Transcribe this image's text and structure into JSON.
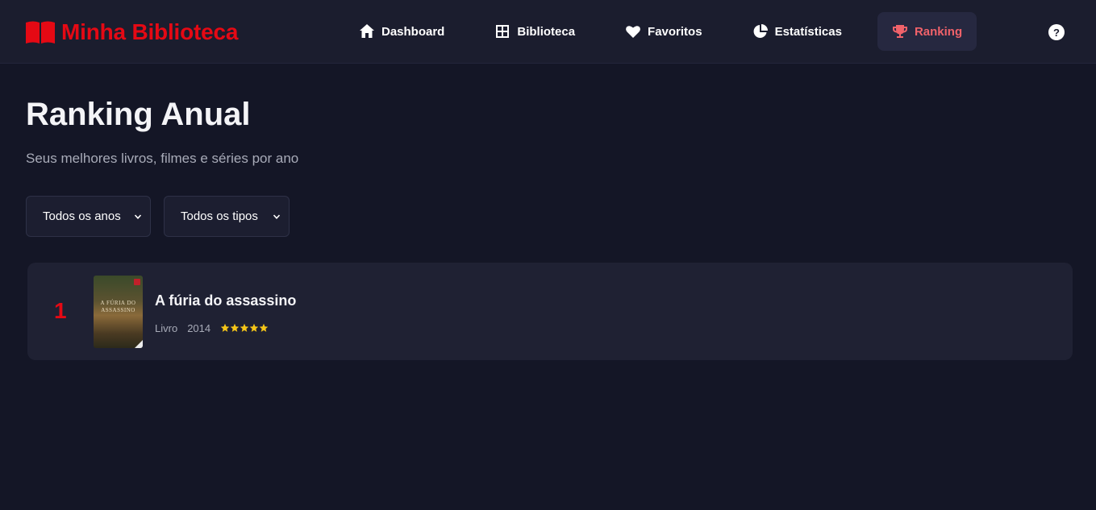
{
  "app": {
    "title": "Minha Biblioteca",
    "accent_color": "#e50914",
    "logo_icon": "book-open-icon"
  },
  "nav": {
    "items": [
      {
        "label": "Dashboard",
        "icon": "home-icon",
        "active": false
      },
      {
        "label": "Biblioteca",
        "icon": "grid-icon",
        "active": false
      },
      {
        "label": "Favoritos",
        "icon": "heart-icon",
        "active": false
      },
      {
        "label": "Estatísticas",
        "icon": "pie-chart-icon",
        "active": false
      },
      {
        "label": "Ranking",
        "icon": "trophy-icon",
        "active": true
      }
    ],
    "help_label": "?"
  },
  "page": {
    "title": "Ranking Anual",
    "subtitle": "Seus melhores livros, filmes e séries por ano"
  },
  "filters": {
    "year": {
      "selected": "Todos os anos"
    },
    "type": {
      "selected": "Todos os tipos"
    }
  },
  "ranking": [
    {
      "position": "1",
      "title": "A fúria do assassino",
      "type": "Livro",
      "year": "2014",
      "rating": 5
    }
  ]
}
